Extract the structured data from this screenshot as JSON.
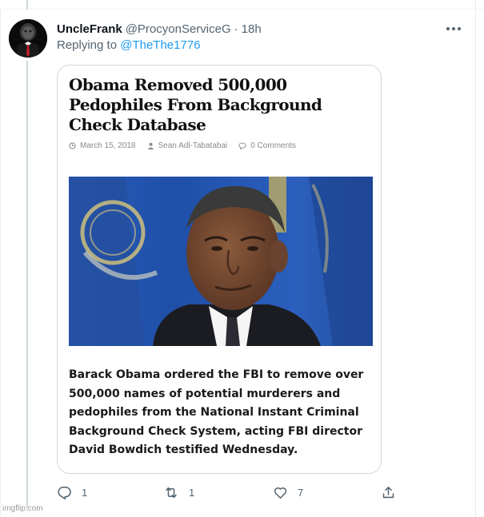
{
  "tweet": {
    "author_name": "UncleFrank",
    "author_handle": "@ProcyonServiceG",
    "separator": "·",
    "time": "18h",
    "replying_prefix": "Replying to",
    "replying_to": "@TheThe1776"
  },
  "article": {
    "headline": "Obama Removed 500,000 Pedophiles From Background Check Database",
    "date": "March 15, 2018",
    "author": "Sean Adl-Tabatabai",
    "comments": "0 Comments",
    "lede": "Barack Obama ordered the FBI to remove over 500,000 names of potential murderers and pedophiles from the National Instant Criminal Background Check System, acting FBI director David Bowdich testified Wednesday."
  },
  "actions": {
    "reply_count": "1",
    "retweet_count": "1",
    "like_count": "7"
  },
  "watermark": "imgflip.com",
  "colors": {
    "link_blue": "#1d9bf0",
    "secondary_text": "#536471",
    "border": "#cfd9de",
    "fbi_flag_blue": "#1f4fa8"
  },
  "icons": [
    "more-icon",
    "reply-icon",
    "retweet-icon",
    "like-icon",
    "share-icon",
    "clock-icon",
    "person-icon",
    "comment-icon"
  ]
}
